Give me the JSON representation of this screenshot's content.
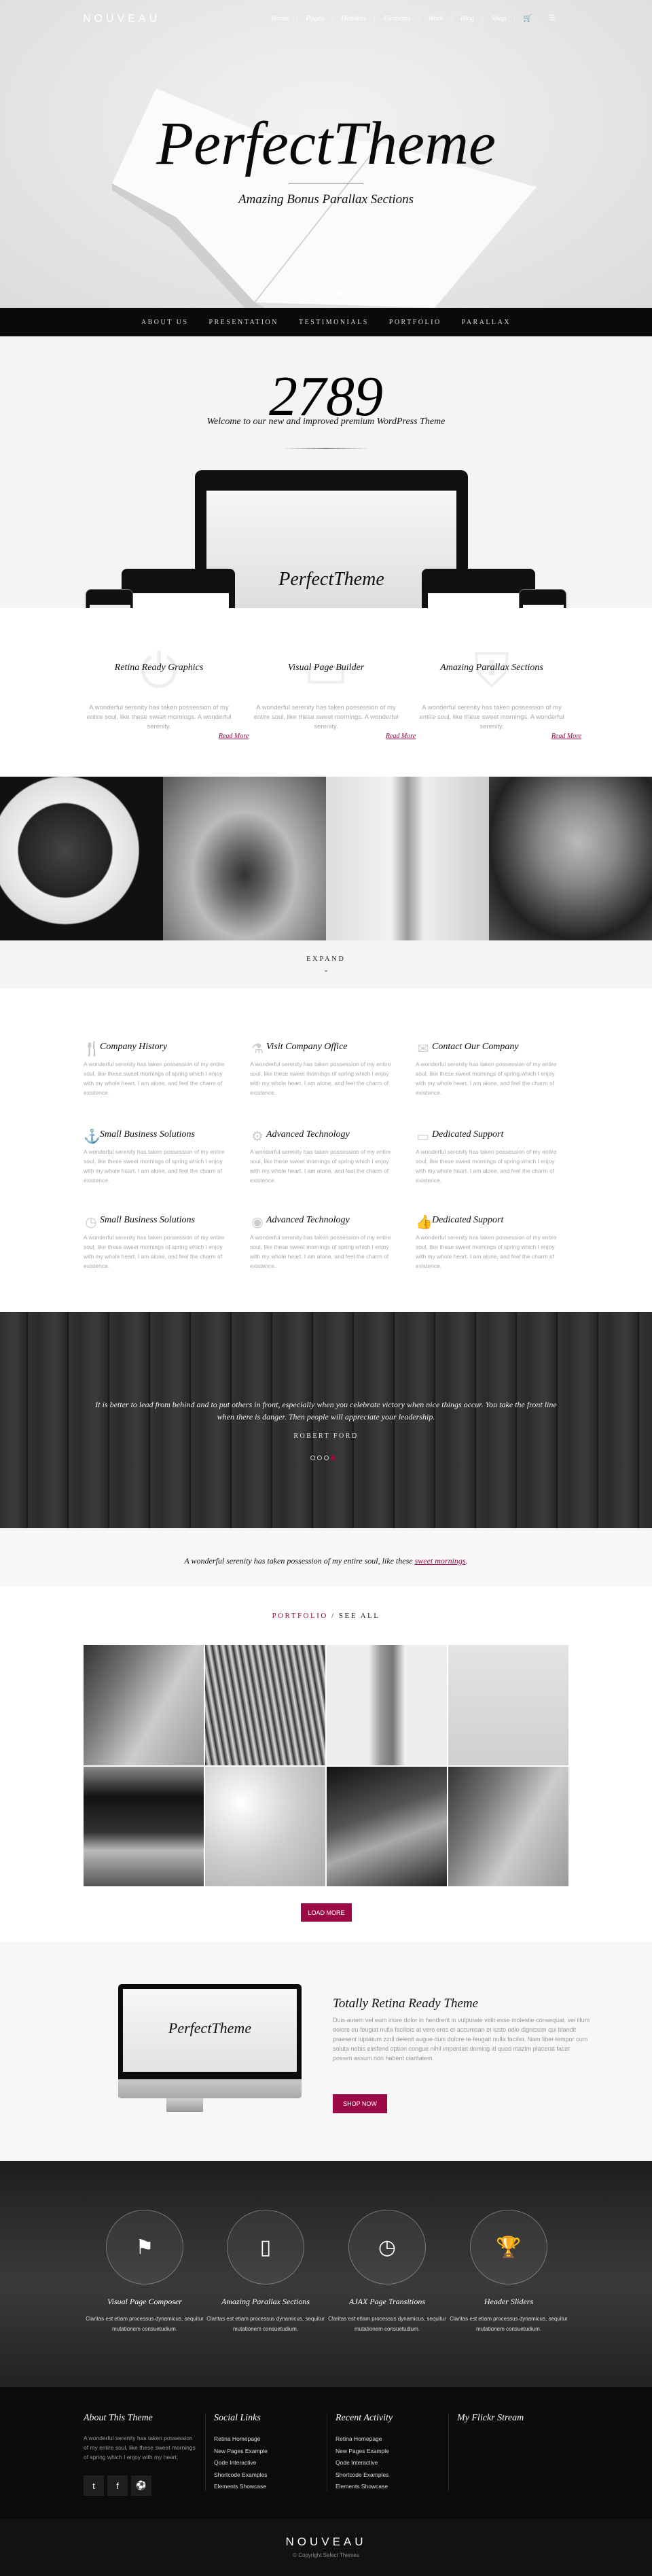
{
  "header": {
    "logo": "NOUVEAU",
    "nav": [
      "Home",
      "Pages",
      "Headers",
      "Elements",
      "Work",
      "Blog",
      "Shop"
    ],
    "cart_icon": "cart-icon",
    "menu_icon": "menu-icon"
  },
  "hero": {
    "title": "PerfectTheme",
    "subtitle": "Amazing Bonus Parallax Sections",
    "slides": 4,
    "active_slide": 4
  },
  "section_nav": [
    "ABOUT US",
    "PRESENTATION",
    "TESTIMONIALS",
    "PORTFOLIO",
    "PARALLAX"
  ],
  "counter": {
    "number": "2789",
    "welcome": "Welcome to our new and improved premium WordPress Theme",
    "device_title": "PerfectTheme"
  },
  "features": [
    {
      "title": "Retina Ready Graphics",
      "text": "A wonderful serenity has taken possession of my entire soul, like these sweet mornings. A wonderful serenity.",
      "link": "Read More",
      "icon": "power-icon"
    },
    {
      "title": "Visual Page Builder",
      "text": "A wonderful serenity has taken possession of my entire soul, like these sweet mornings. A wonderful serenity.",
      "link": "Read More",
      "icon": "laptop-icon"
    },
    {
      "title": "Amazing Parallax Sections",
      "text": "A wonderful serenity has taken possession of my entire soul, like these sweet mornings. A wonderful serenity.",
      "link": "Read More",
      "icon": "shield-icon"
    }
  ],
  "expand": {
    "label": "EXPAND"
  },
  "services": [
    {
      "title": "Company History",
      "icon": "cutlery-icon"
    },
    {
      "title": "Visit Company Office",
      "icon": "flask-icon"
    },
    {
      "title": "Contact Our Company",
      "icon": "envelope-icon"
    },
    {
      "title": "Small Business Solutions",
      "icon": "anchor-icon"
    },
    {
      "title": "Advanced Technology",
      "icon": "gear-icon"
    },
    {
      "title": "Dedicated Support",
      "icon": "laptop-icon"
    },
    {
      "title": "Small Business Solutions",
      "icon": "clock-icon"
    },
    {
      "title": "Advanced Technology",
      "icon": "eye-icon"
    },
    {
      "title": "Dedicated Support",
      "icon": "thumbs-up-icon"
    }
  ],
  "service_text": "A wonderful serenity has taken possession of my entire soul, like these sweet mornings of spring which I enjoy with my whole heart. I am alone, and feel the charm of existence.",
  "testimonial": {
    "quote": "It is better to lead from behind and to put others in front, especially when you celebrate victory when nice things occur. You take the front line when there is danger. Then people will appreciate your leadership.",
    "author": "ROBERT FORD",
    "slides": 4,
    "active_slide": 4
  },
  "serenity": {
    "text": "A wonderful serenity has taken possession of my entire soul, like these ",
    "link": "sweet mornings",
    "end": "."
  },
  "portfolio": {
    "title": "PORTFOLIO",
    "separator": " / ",
    "see_all": "SEE ALL",
    "load_more": "LOAD MORE"
  },
  "retina": {
    "title": "Totally Retina Ready Theme",
    "text": "Duis autem vel eum iriure dolor in hendrerit in vulputate velit esse molestie consequat, vel illum dolore eu feugiat nulla facilisis at vero eros et accumsan et iusto odio dignissim qui blandit praesent luptatum zzril delenit augue duis dolore te feugait nulla facilisi. Nam liber tempor cum soluta nobis eleifend option congue nihil imperdiet doming id quod mazim placerat facer possim assum non habent claritatem.",
    "button": "SHOP NOW",
    "screen_title": "PerfectTheme"
  },
  "parallax": [
    {
      "title": "Visual Page Composer",
      "text": "Claritas est etiam processus dynamicus, sequitur mutationem consuetudium.",
      "icon": "flag-icon"
    },
    {
      "title": "Amazing Parallax Sections",
      "text": "Claritas est etiam processus dynamicus, sequitur mutationem consuetudium.",
      "icon": "tablet-icon"
    },
    {
      "title": "AJAX Page Transitions",
      "text": "Claritas est etiam processus dynamicus, sequitur mutationem consuetudium.",
      "icon": "clock-icon"
    },
    {
      "title": "Header Sliders",
      "text": "Claritas est etiam processus dynamicus, sequitur mutationem consuetudium.",
      "icon": "trophy-icon"
    }
  ],
  "footer": {
    "about": {
      "title": "About This Theme",
      "text": "A wonderful serenity has taken possession of my entire soul, like these sweet mornings of spring which I enjoy with my heart.",
      "social": [
        "twitter-icon",
        "facebook-icon",
        "dribbble-icon"
      ]
    },
    "social_links": {
      "title": "Social Links",
      "items": [
        "Retina Homepage",
        "New Pages Example",
        "Qode Interactive",
        "Shortcode Examples",
        "Elements Showcase"
      ]
    },
    "recent": {
      "title": "Recent Activity",
      "items": [
        "Retina Homepage",
        "New Pages Example",
        "Qode Interactive",
        "Shortcode Examples",
        "Elements Showcase"
      ]
    },
    "flickr": {
      "title": "My Flickr Stream"
    },
    "logo": "NOUVEAU",
    "copyright": "© Copyright Select Themes"
  },
  "colors": {
    "accent": "#9b0a45",
    "dark": "#0b0b0b"
  }
}
